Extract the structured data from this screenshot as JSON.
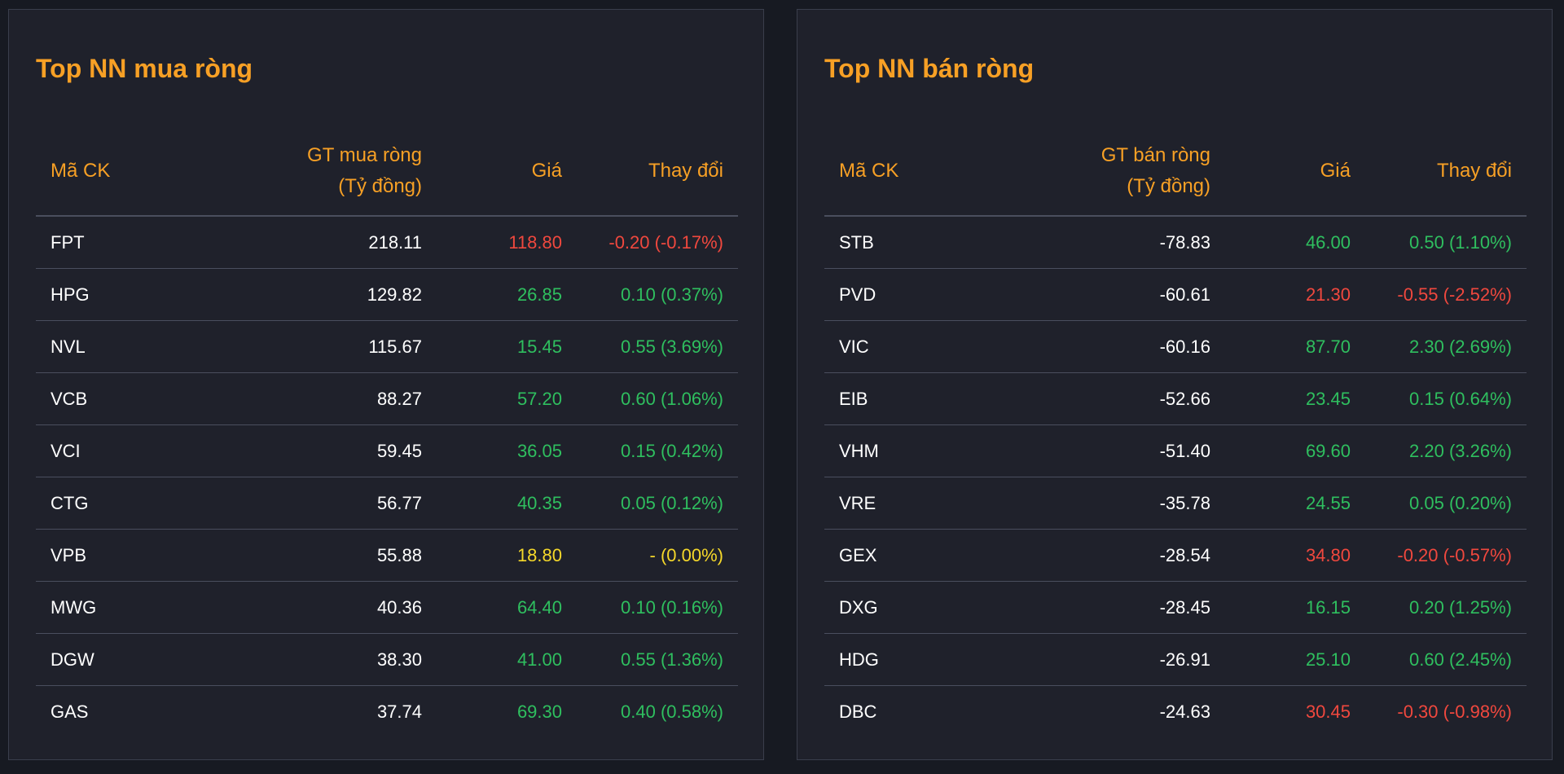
{
  "colors": {
    "title": "#f7a025",
    "up": "#2fbf5f",
    "down": "#f0483e",
    "flat": "#f5d82a"
  },
  "buy": {
    "title": "Top NN mua ròng",
    "headers": {
      "code": "Mã CK",
      "value": "GT mua ròng\n(Tỷ đồng)",
      "price": "Giá",
      "change": "Thay đổi"
    },
    "rows": [
      {
        "code": "FPT",
        "value": "218.11",
        "price": "118.80",
        "change": "-0.20 (-0.17%)",
        "trend": "down"
      },
      {
        "code": "HPG",
        "value": "129.82",
        "price": "26.85",
        "change": "0.10 (0.37%)",
        "trend": "up"
      },
      {
        "code": "NVL",
        "value": "115.67",
        "price": "15.45",
        "change": "0.55 (3.69%)",
        "trend": "up"
      },
      {
        "code": "VCB",
        "value": "88.27",
        "price": "57.20",
        "change": "0.60 (1.06%)",
        "trend": "up"
      },
      {
        "code": "VCI",
        "value": "59.45",
        "price": "36.05",
        "change": "0.15 (0.42%)",
        "trend": "up"
      },
      {
        "code": "CTG",
        "value": "56.77",
        "price": "40.35",
        "change": "0.05 (0.12%)",
        "trend": "up"
      },
      {
        "code": "VPB",
        "value": "55.88",
        "price": "18.80",
        "change": "- (0.00%)",
        "trend": "flat"
      },
      {
        "code": "MWG",
        "value": "40.36",
        "price": "64.40",
        "change": "0.10 (0.16%)",
        "trend": "up"
      },
      {
        "code": "DGW",
        "value": "38.30",
        "price": "41.00",
        "change": "0.55 (1.36%)",
        "trend": "up"
      },
      {
        "code": "GAS",
        "value": "37.74",
        "price": "69.30",
        "change": "0.40 (0.58%)",
        "trend": "up"
      }
    ]
  },
  "sell": {
    "title": "Top NN bán ròng",
    "headers": {
      "code": "Mã CK",
      "value": "GT bán ròng\n(Tỷ đồng)",
      "price": "Giá",
      "change": "Thay đổi"
    },
    "rows": [
      {
        "code": "STB",
        "value": "-78.83",
        "price": "46.00",
        "change": "0.50 (1.10%)",
        "trend": "up"
      },
      {
        "code": "PVD",
        "value": "-60.61",
        "price": "21.30",
        "change": "-0.55 (-2.52%)",
        "trend": "down"
      },
      {
        "code": "VIC",
        "value": "-60.16",
        "price": "87.70",
        "change": "2.30 (2.69%)",
        "trend": "up"
      },
      {
        "code": "EIB",
        "value": "-52.66",
        "price": "23.45",
        "change": "0.15 (0.64%)",
        "trend": "up"
      },
      {
        "code": "VHM",
        "value": "-51.40",
        "price": "69.60",
        "change": "2.20 (3.26%)",
        "trend": "up"
      },
      {
        "code": "VRE",
        "value": "-35.78",
        "price": "24.55",
        "change": "0.05 (0.20%)",
        "trend": "up"
      },
      {
        "code": "GEX",
        "value": "-28.54",
        "price": "34.80",
        "change": "-0.20 (-0.57%)",
        "trend": "down"
      },
      {
        "code": "DXG",
        "value": "-28.45",
        "price": "16.15",
        "change": "0.20 (1.25%)",
        "trend": "up"
      },
      {
        "code": "HDG",
        "value": "-26.91",
        "price": "25.10",
        "change": "0.60 (2.45%)",
        "trend": "up"
      },
      {
        "code": "DBC",
        "value": "-24.63",
        "price": "30.45",
        "change": "-0.30 (-0.98%)",
        "trend": "down"
      }
    ]
  }
}
